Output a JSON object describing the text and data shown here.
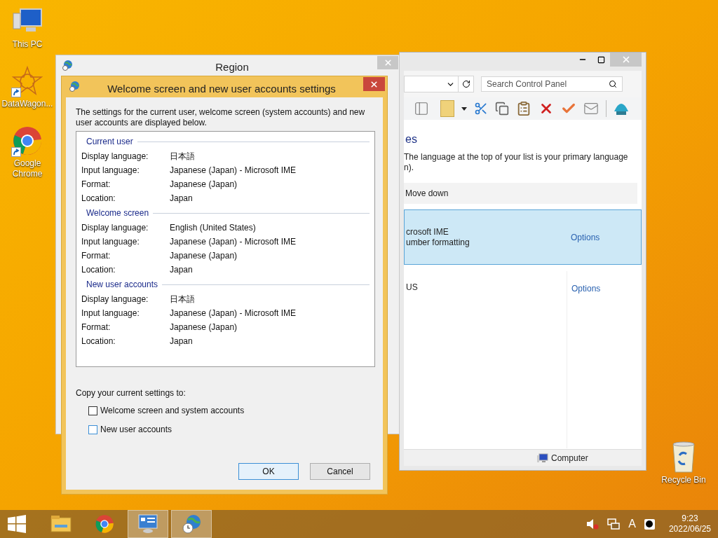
{
  "desktop_icons": [
    {
      "label": "This PC",
      "kind": "pc",
      "shortcut": false
    },
    {
      "label": "DataWagon...",
      "kind": "star",
      "shortcut": true
    },
    {
      "label": "Google Chrome",
      "kind": "chrome",
      "shortcut": true
    }
  ],
  "recycle_bin": {
    "label": "Recycle Bin"
  },
  "control_panel": {
    "search": {
      "placeholder": "Search Control Panel"
    },
    "heading": "es",
    "description": [
      "The language at the top of your list is your primary language",
      "n)."
    ],
    "move_down": "Move down",
    "languages": [
      {
        "lines": [
          "crosoft IME",
          "umber formatting"
        ],
        "options": "Options",
        "selected": true
      },
      {
        "lines": [
          "US"
        ],
        "options": "Options",
        "selected": false
      }
    ],
    "status": "Computer"
  },
  "region_window": {
    "title": "Region"
  },
  "dialog": {
    "title": "Welcome screen and new user accounts settings",
    "intro": "The settings for the current user, welcome screen (system accounts) and new user accounts are displayed below.",
    "sections": [
      {
        "heading": "Current user",
        "rows": [
          {
            "label": "Display language:",
            "value": "日本語"
          },
          {
            "label": "Input language:",
            "value": "Japanese (Japan) - Microsoft IME"
          },
          {
            "label": "Format:",
            "value": "Japanese (Japan)"
          },
          {
            "label": "Location:",
            "value": "Japan"
          }
        ]
      },
      {
        "heading": "Welcome screen",
        "rows": [
          {
            "label": "Display language:",
            "value": "English (United States)"
          },
          {
            "label": "Input language:",
            "value": "Japanese (Japan) - Microsoft IME"
          },
          {
            "label": "Format:",
            "value": "Japanese (Japan)"
          },
          {
            "label": "Location:",
            "value": "Japan"
          }
        ]
      },
      {
        "heading": "New user accounts",
        "rows": [
          {
            "label": "Display language:",
            "value": "日本語"
          },
          {
            "label": "Input language:",
            "value": "Japanese (Japan) - Microsoft IME"
          },
          {
            "label": "Format:",
            "value": "Japanese (Japan)"
          },
          {
            "label": "Location:",
            "value": "Japan"
          }
        ]
      }
    ],
    "copy_label": "Copy your current settings to:",
    "checkboxes": [
      {
        "label": "Welcome screen and system accounts",
        "checked": false,
        "hovered": false
      },
      {
        "label": "New user accounts",
        "checked": false,
        "hovered": true
      }
    ],
    "buttons": [
      {
        "label": "OK",
        "default": true
      },
      {
        "label": "Cancel",
        "default": false
      }
    ]
  },
  "taskbar": {
    "apps": [
      {
        "kind": "explorer",
        "running": false
      },
      {
        "kind": "chrome",
        "running": false
      },
      {
        "kind": "control_panel",
        "running": true
      },
      {
        "kind": "region",
        "running": true
      }
    ],
    "ime": "A",
    "time": "9:23",
    "date": "2022/06/25"
  }
}
